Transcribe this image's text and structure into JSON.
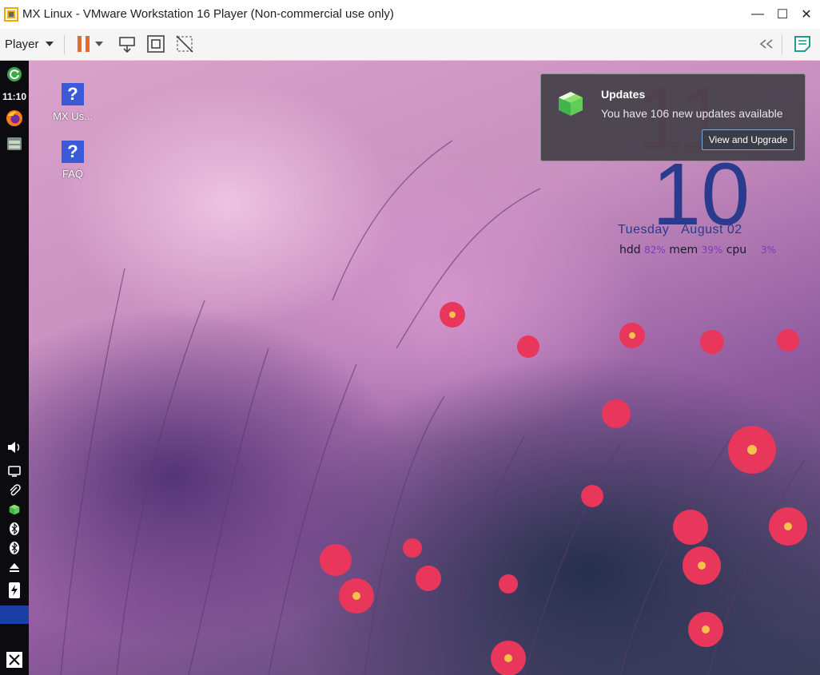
{
  "window": {
    "title": "MX Linux - VMware Workstation 16 Player (Non-commercial use only)",
    "minimize": "—",
    "maximize": "☐",
    "close": "✕"
  },
  "toolbar": {
    "player_menu": "Player",
    "icons": [
      "pause-icon",
      "dropdown-icon",
      "send-ctrl-alt-del-icon",
      "fullscreen-icon",
      "unity-icon",
      "collapse-icon",
      "notes-icon"
    ]
  },
  "taskbar": {
    "clock": "11:10",
    "items": [
      "update-icon",
      "firefox-icon",
      "files-icon",
      "volume-icon",
      "display-icon",
      "clipboard-icon",
      "package-icon",
      "bluetooth-icon",
      "bluetooth-icon",
      "eject-icon",
      "power-icon",
      "mx-logo-icon"
    ]
  },
  "desktop": {
    "icons": [
      {
        "label": "MX Us...",
        "icon": "help-icon"
      },
      {
        "label": "FAQ",
        "icon": "help-icon"
      }
    ]
  },
  "conky": {
    "hour": "11",
    "minute": "10",
    "day": "Tuesday",
    "date": "August 02",
    "hdd_label": "hdd",
    "hdd": "82%",
    "mem_label": "mem",
    "mem": "39%",
    "cpu_label": "cpu",
    "cpu": "3%"
  },
  "notification": {
    "title": "Updates",
    "body": "You have 106 new updates available",
    "action": "View and Upgrade"
  },
  "colors": {
    "accent": "#e8692a",
    "taskbar": "#0b0b10",
    "active_window": "#1c3fa6",
    "conky_date": "#2a3a8c",
    "conky_value": "#7a3cb8"
  }
}
